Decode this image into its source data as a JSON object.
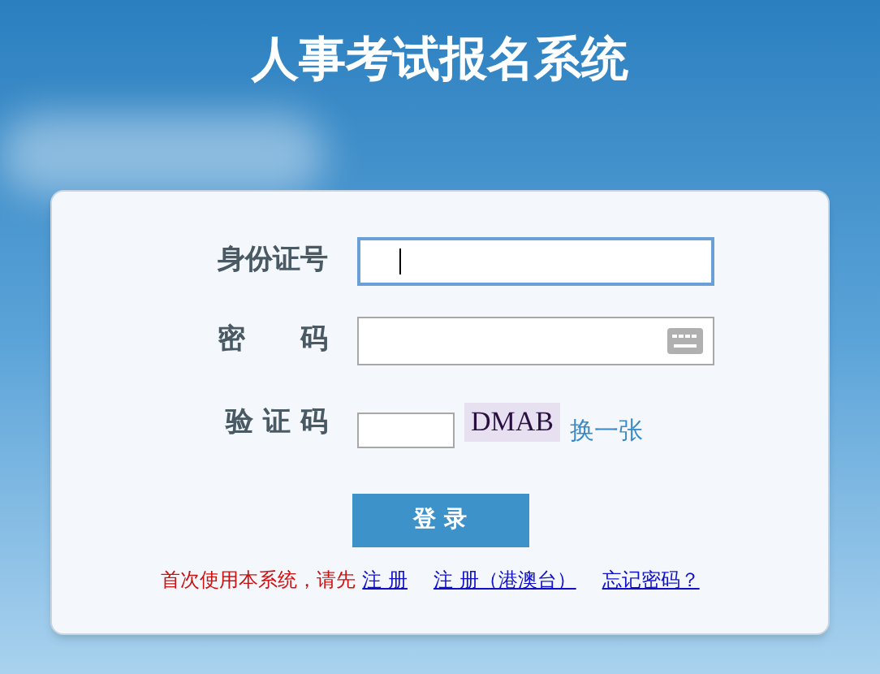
{
  "title": "人事考试报名系统",
  "form": {
    "fields": [
      {
        "kind": "text",
        "label": "身份证号",
        "focused": true
      },
      {
        "kind": "password",
        "label": "密　　码",
        "focused": false
      },
      {
        "kind": "captcha",
        "label": "验 证 码",
        "focused": false,
        "captcha": "DMAB",
        "refresh": "换一张"
      }
    ],
    "submit": "登 录",
    "footer": {
      "prompt": "首次使用本系统，请先",
      "links": [
        "注 册",
        "注 册（港澳台）",
        "忘记密码？"
      ]
    }
  }
}
